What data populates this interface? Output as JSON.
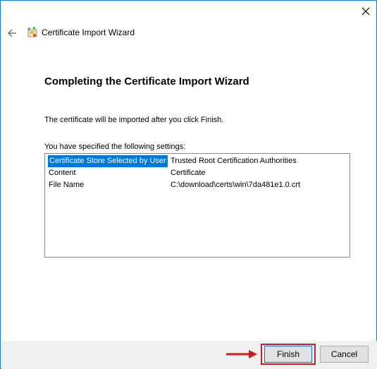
{
  "window": {
    "title": "Certificate Import Wizard"
  },
  "page": {
    "heading": "Completing the Certificate Import Wizard",
    "intro": "The certificate will be imported after you click Finish.",
    "settings_label": "You have specified the following settings:"
  },
  "settings": [
    {
      "name": "Certificate Store Selected by User",
      "value": "Trusted Root Certification Authorities",
      "selected": true
    },
    {
      "name": "Content",
      "value": "Certificate",
      "selected": false
    },
    {
      "name": "File Name",
      "value": "C:\\download\\certs\\win\\7da481e1.0.crt",
      "selected": false
    }
  ],
  "buttons": {
    "finish": "Finish",
    "cancel": "Cancel"
  },
  "colors": {
    "selection": "#0078d7",
    "highlight_annotation": "#c8202a"
  },
  "icons": {
    "close": "close-icon",
    "back": "back-arrow-icon",
    "wizard": "certificate-wizard-icon",
    "annotation": "red-arrow-icon"
  }
}
